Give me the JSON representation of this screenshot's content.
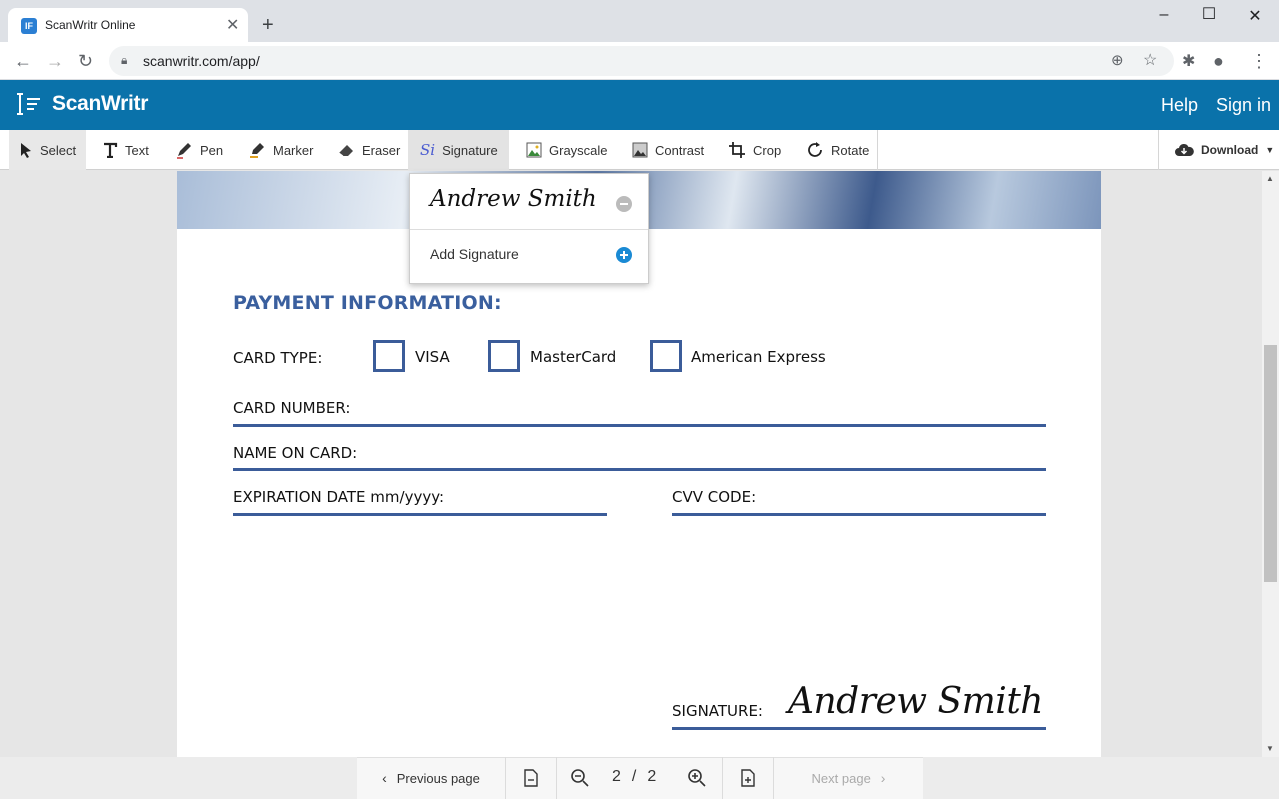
{
  "browser": {
    "tab_title": "ScanWritr Online",
    "tab_favicon": "scanwritr-favicon",
    "url": "scanwritr.com/app/"
  },
  "app": {
    "logo_text": "ScanWritr",
    "header_links": {
      "help": "Help",
      "sign_in": "Sign in"
    },
    "brand_color": "#0a72aa"
  },
  "toolbar": {
    "tools": [
      {
        "id": "select",
        "label": "Select",
        "icon": "cursor-icon"
      },
      {
        "id": "text",
        "label": "Text",
        "icon": "text-t-icon"
      },
      {
        "id": "pen",
        "label": "Pen",
        "icon": "pen-icon"
      },
      {
        "id": "marker",
        "label": "Marker",
        "icon": "marker-icon"
      },
      {
        "id": "eraser",
        "label": "Eraser",
        "icon": "eraser-icon"
      },
      {
        "id": "signature",
        "label": "Signature",
        "icon": "signature-icon",
        "active": true
      },
      {
        "id": "grayscale",
        "label": "Grayscale",
        "icon": "grayscale-icon"
      },
      {
        "id": "contrast",
        "label": "Contrast",
        "icon": "contrast-icon"
      },
      {
        "id": "crop",
        "label": "Crop",
        "icon": "crop-icon"
      },
      {
        "id": "rotate",
        "label": "Rotate",
        "icon": "rotate-icon"
      }
    ],
    "download_label": "Download"
  },
  "signature_menu": {
    "saved_signature": "Andrew Smith",
    "add_label": "Add Signature"
  },
  "document": {
    "heading": "PAYMENT INFORMATION:",
    "card_type_label": "CARD TYPE:",
    "card_options": [
      "VISA",
      "MasterCard",
      "American Express"
    ],
    "card_number_label": "CARD NUMBER:",
    "name_on_card_label": "NAME ON CARD:",
    "expiration_label": "EXPIRATION DATE mm/yyyy:",
    "cvv_label": "CVV CODE:",
    "signature_label": "SIGNATURE:",
    "signature_value": "Andrew Smith"
  },
  "pager": {
    "previous_label": "Previous page",
    "current_page": "2",
    "separator": "/",
    "total_pages": "2",
    "next_label": "Next page"
  }
}
